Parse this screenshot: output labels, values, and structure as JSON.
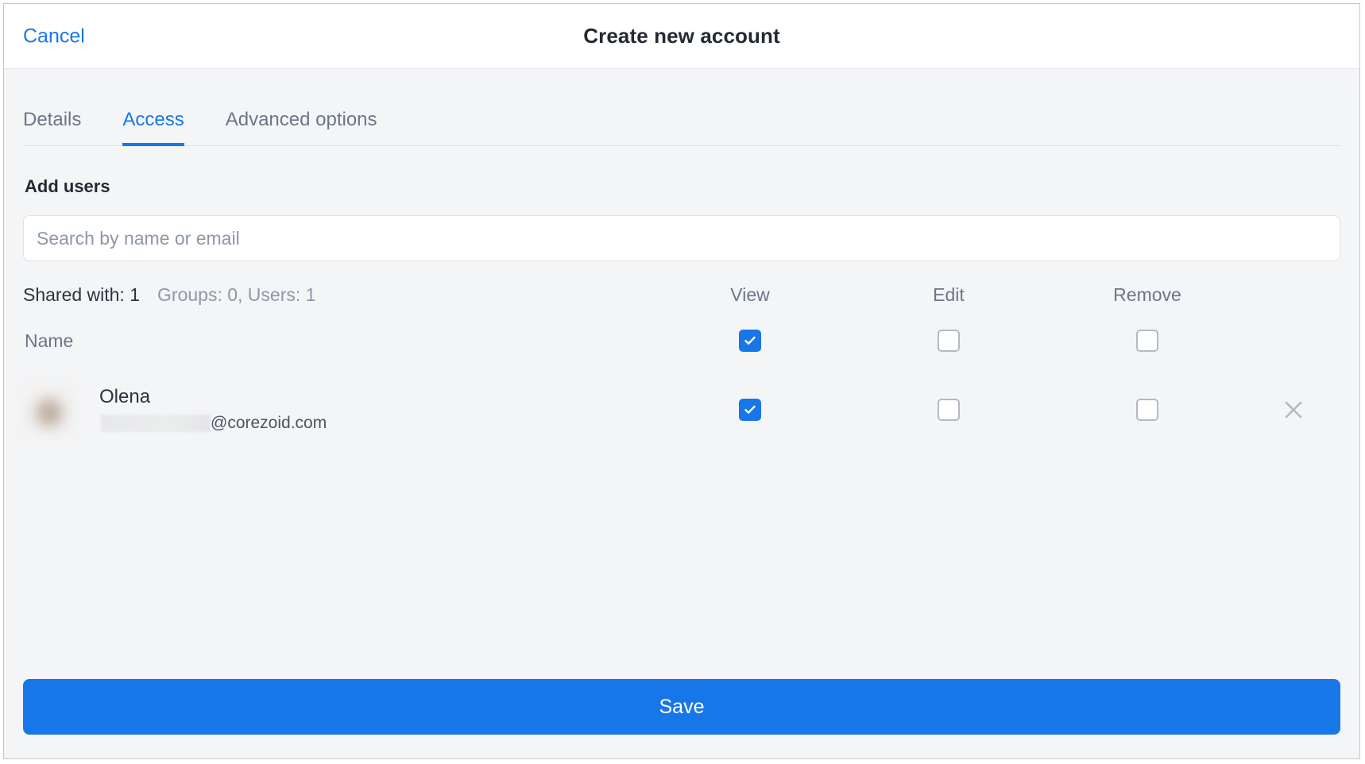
{
  "window": {
    "title": "Create new account",
    "cancel_label": "Cancel"
  },
  "tabs": [
    {
      "label": "Details",
      "active": false
    },
    {
      "label": "Access",
      "active": true
    },
    {
      "label": "Advanced options",
      "active": false
    }
  ],
  "section": {
    "add_users_label": "Add users"
  },
  "search": {
    "placeholder": "Search by name or email",
    "value": ""
  },
  "sharing": {
    "shared_with": "Shared with: 1",
    "counts": "Groups: 0, Users: 1"
  },
  "columns": {
    "view": "View",
    "edit": "Edit",
    "remove": "Remove"
  },
  "name_row": {
    "label": "Name",
    "view_checked": true,
    "edit_checked": false,
    "remove_checked": false
  },
  "users": [
    {
      "name": "Olena",
      "email_redacted": "",
      "email_domain": "@corezoid.com",
      "view_checked": true,
      "edit_checked": false,
      "remove_checked": false,
      "delete_icon": "close-icon"
    }
  ],
  "footer": {
    "save_label": "Save"
  },
  "colors": {
    "accent": "#1877e8",
    "background": "#f4f5f7",
    "header_background": "#ffffff",
    "text_primary": "#2c3440",
    "text_muted": "#6b7785",
    "border": "#dfe1e5",
    "checkbox_border": "#b2bac4"
  }
}
